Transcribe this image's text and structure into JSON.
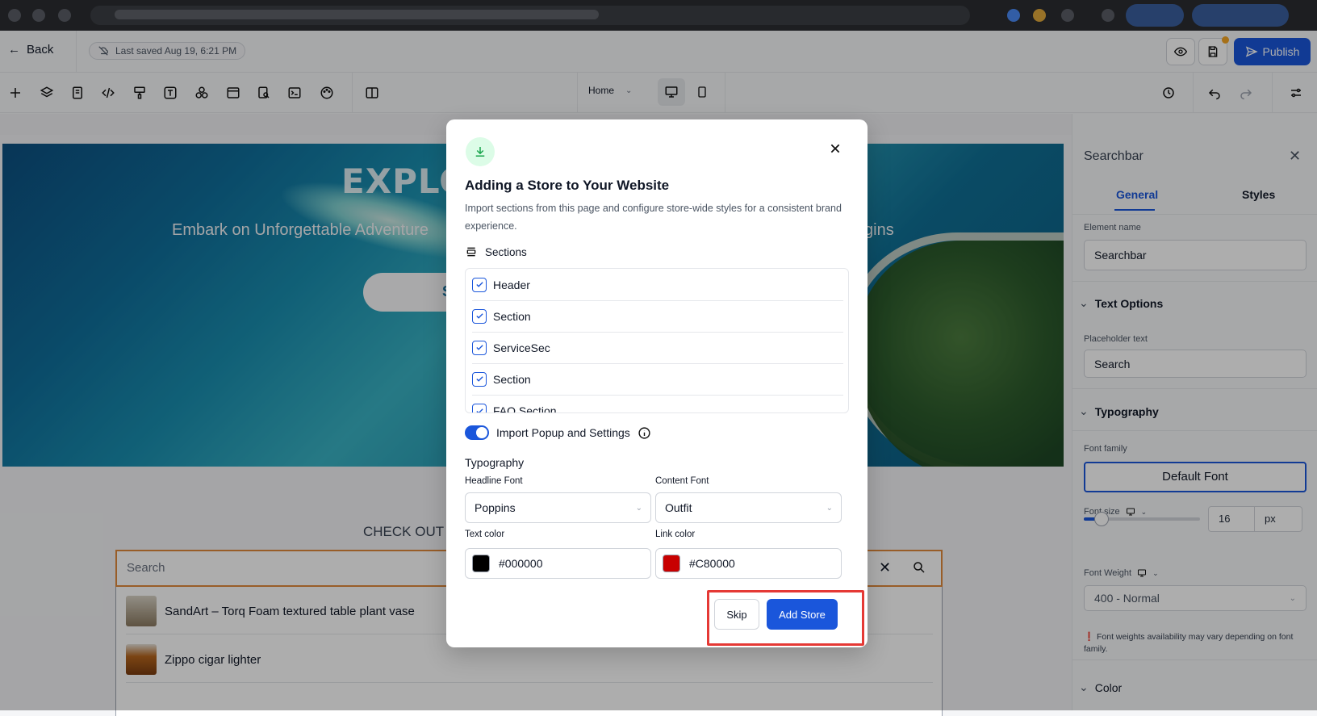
{
  "colors": {
    "accent": "#1a56db",
    "highlight": "#e53935",
    "search_border": "#e08a3c",
    "text_swatch": "#000000",
    "link_swatch": "#C80000"
  },
  "header": {
    "back_label": "Back",
    "last_saved": "Last saved Aug 19, 6:21 PM",
    "publish_label": "Publish",
    "page_select": "Home"
  },
  "toolbar_icons": [
    "add-icon",
    "layers-icon",
    "pages-icon",
    "code-icon",
    "paint-icon",
    "text-icon",
    "elements-icon",
    "layout-icon",
    "seo-icon",
    "terminal-icon",
    "palette-icon",
    "split-view-icon"
  ],
  "canvas": {
    "hero_title": "EXPLO",
    "hero_subtitle": "Embark on Unforgettable Adventure",
    "hero_subtitle_tail": "gins",
    "cta_letter": "S",
    "url_tail": "ain",
    "checkout_heading": "CHECK OUT",
    "search_placeholder": "Search",
    "results": [
      {
        "title": "SandArt – Torq Foam textured table plant vase"
      },
      {
        "title": "Zippo cigar lighter"
      }
    ]
  },
  "right_panel": {
    "title": "Searchbar",
    "tabs": [
      "General",
      "Styles"
    ],
    "element_name_label": "Element name",
    "element_name_value": "Searchbar",
    "text_options": "Text Options",
    "placeholder_label": "Placeholder text",
    "placeholder_value": "Search",
    "typography": "Typography",
    "font_family_label": "Font family",
    "font_family_value": "Default Font",
    "font_size_label": "Font size",
    "font_size_value": "16",
    "font_size_unit": "px",
    "font_size_fraction": 0.15,
    "font_weight_label": "Font Weight",
    "font_weight_value": "400 - Normal",
    "font_weight_note": "Font weights availability may vary depending on font family.",
    "color_section": "Color"
  },
  "modal": {
    "title": "Adding a Store to Your Website",
    "description": "Import sections from this page and configure store-wide styles for a consistent brand experience.",
    "sections_label": "Sections",
    "sections": [
      {
        "label": "Header",
        "checked": true
      },
      {
        "label": "Section",
        "checked": true
      },
      {
        "label": "ServiceSec",
        "checked": true
      },
      {
        "label": "Section",
        "checked": true
      },
      {
        "label": "FAQ Section",
        "checked": true
      }
    ],
    "import_toggle_label": "Import Popup and Settings",
    "import_toggle_on": true,
    "typography_label": "Typography",
    "headline_font_label": "Headline Font",
    "headline_font_value": "Poppins",
    "content_font_label": "Content Font",
    "content_font_value": "Outfit",
    "text_color_label": "Text color",
    "text_color_value": "#000000",
    "link_color_label": "Link color",
    "link_color_value": "#C80000",
    "skip_label": "Skip",
    "add_store_label": "Add Store"
  }
}
